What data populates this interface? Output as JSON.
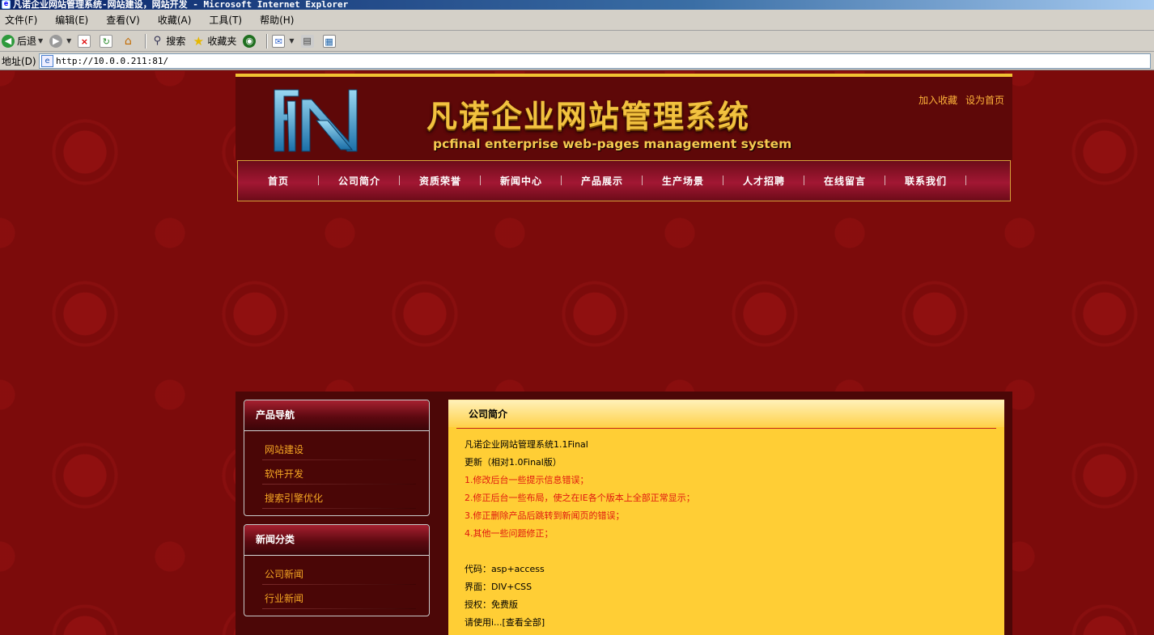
{
  "window": {
    "title": "凡诺企业网站管理系统-网站建设，网站开发 - Microsoft Internet Explorer"
  },
  "menu": [
    "文件(F)",
    "编辑(E)",
    "查看(V)",
    "收藏(A)",
    "工具(T)",
    "帮助(H)"
  ],
  "toolbar": {
    "back": "后退",
    "search": "搜索",
    "favorites": "收藏夹"
  },
  "address": {
    "label": "地址(D)",
    "url": "http://10.0.0.211:81/"
  },
  "site": {
    "title": "凡诺企业网站管理系统",
    "subtitle": "pcfinal enterprise web-pages management system",
    "logo_text": "FN",
    "links": {
      "add_favorite": "加入收藏",
      "set_home": "设为首页"
    }
  },
  "nav": [
    "首页",
    "公司简介",
    "资质荣誉",
    "新闻中心",
    "产品展示",
    "生产场景",
    "人才招聘",
    "在线留言",
    "联系我们"
  ],
  "side": {
    "products": {
      "title": "产品导航",
      "items": [
        "网站建设",
        "软件开发",
        "搜索引擎优化"
      ]
    },
    "news": {
      "title": "新闻分类",
      "items": [
        "公司新闻",
        "行业新闻"
      ]
    }
  },
  "intro": {
    "title": "公司简介",
    "lines": [
      "凡诺企业网站管理系统1.1Final",
      "更新（相对1.0Final版）",
      "1.修改后台一些提示信息错误；",
      "2.修正后台一些布局，使之在IE各个版本上全部正常显示；",
      "3.修正删除产品后跳转到新闻页的错误；",
      "4.其他一些问题修正；",
      "代码：asp+access",
      "界面：DIV+CSS",
      "授权：免费版",
      "请使用i...[查看全部]"
    ]
  },
  "colors": {
    "page_bg": "#7c0b0b",
    "gold": "#f2c23f",
    "link": "#f5a623",
    "content_bg": "#ffce35",
    "red_text": "#e0180f"
  }
}
